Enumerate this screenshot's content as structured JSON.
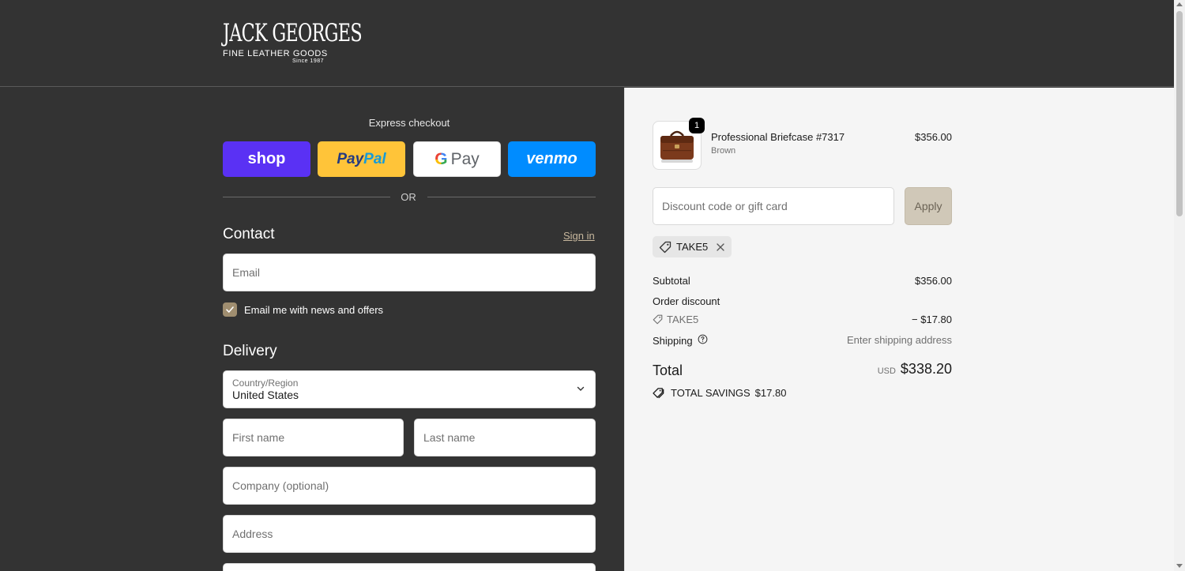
{
  "brand": {
    "name": "JACK GEORGES",
    "tagline": "FINE LEATHER GOODS",
    "since": "Since 1987"
  },
  "express": {
    "title": "Express checkout",
    "shop_label": "shop",
    "paypal_label_1": "Pay",
    "paypal_label_2": "Pal",
    "gpay_g": "G",
    "gpay_label": "Pay",
    "venmo_label": "venmo",
    "or_label": "OR"
  },
  "contact": {
    "title": "Contact",
    "signin_label": "Sign in",
    "email_placeholder": "Email",
    "newsletter_label": "Email me with news and offers",
    "newsletter_checked": true
  },
  "delivery": {
    "title": "Delivery",
    "country_label": "Country/Region",
    "country_value": "United States",
    "first_name_placeholder": "First name",
    "last_name_placeholder": "Last name",
    "company_placeholder": "Company (optional)",
    "address_placeholder": "Address"
  },
  "cart": {
    "item": {
      "quantity": "1",
      "name": "Professional Briefcase #7317",
      "variant": "Brown",
      "price": "$356.00"
    },
    "discount_placeholder": "Discount code or gift card",
    "apply_label": "Apply",
    "applied_code": "TAKE5"
  },
  "summary": {
    "subtotal_label": "Subtotal",
    "subtotal_value": "$356.00",
    "order_discount_label": "Order discount",
    "discount_code": "TAKE5",
    "discount_value": "− $17.80",
    "shipping_label": "Shipping",
    "shipping_value": "Enter shipping address",
    "total_label": "Total",
    "total_currency": "USD",
    "total_value": "$338.20",
    "savings_label": "TOTAL SAVINGS",
    "savings_value": "$17.80"
  },
  "colors": {
    "background_dark": "#333333",
    "summary_bg": "#f5f5f5",
    "accent": "#a08e70",
    "shop_pay": "#5a31f4",
    "paypal": "#ffc439",
    "venmo": "#008cff"
  }
}
